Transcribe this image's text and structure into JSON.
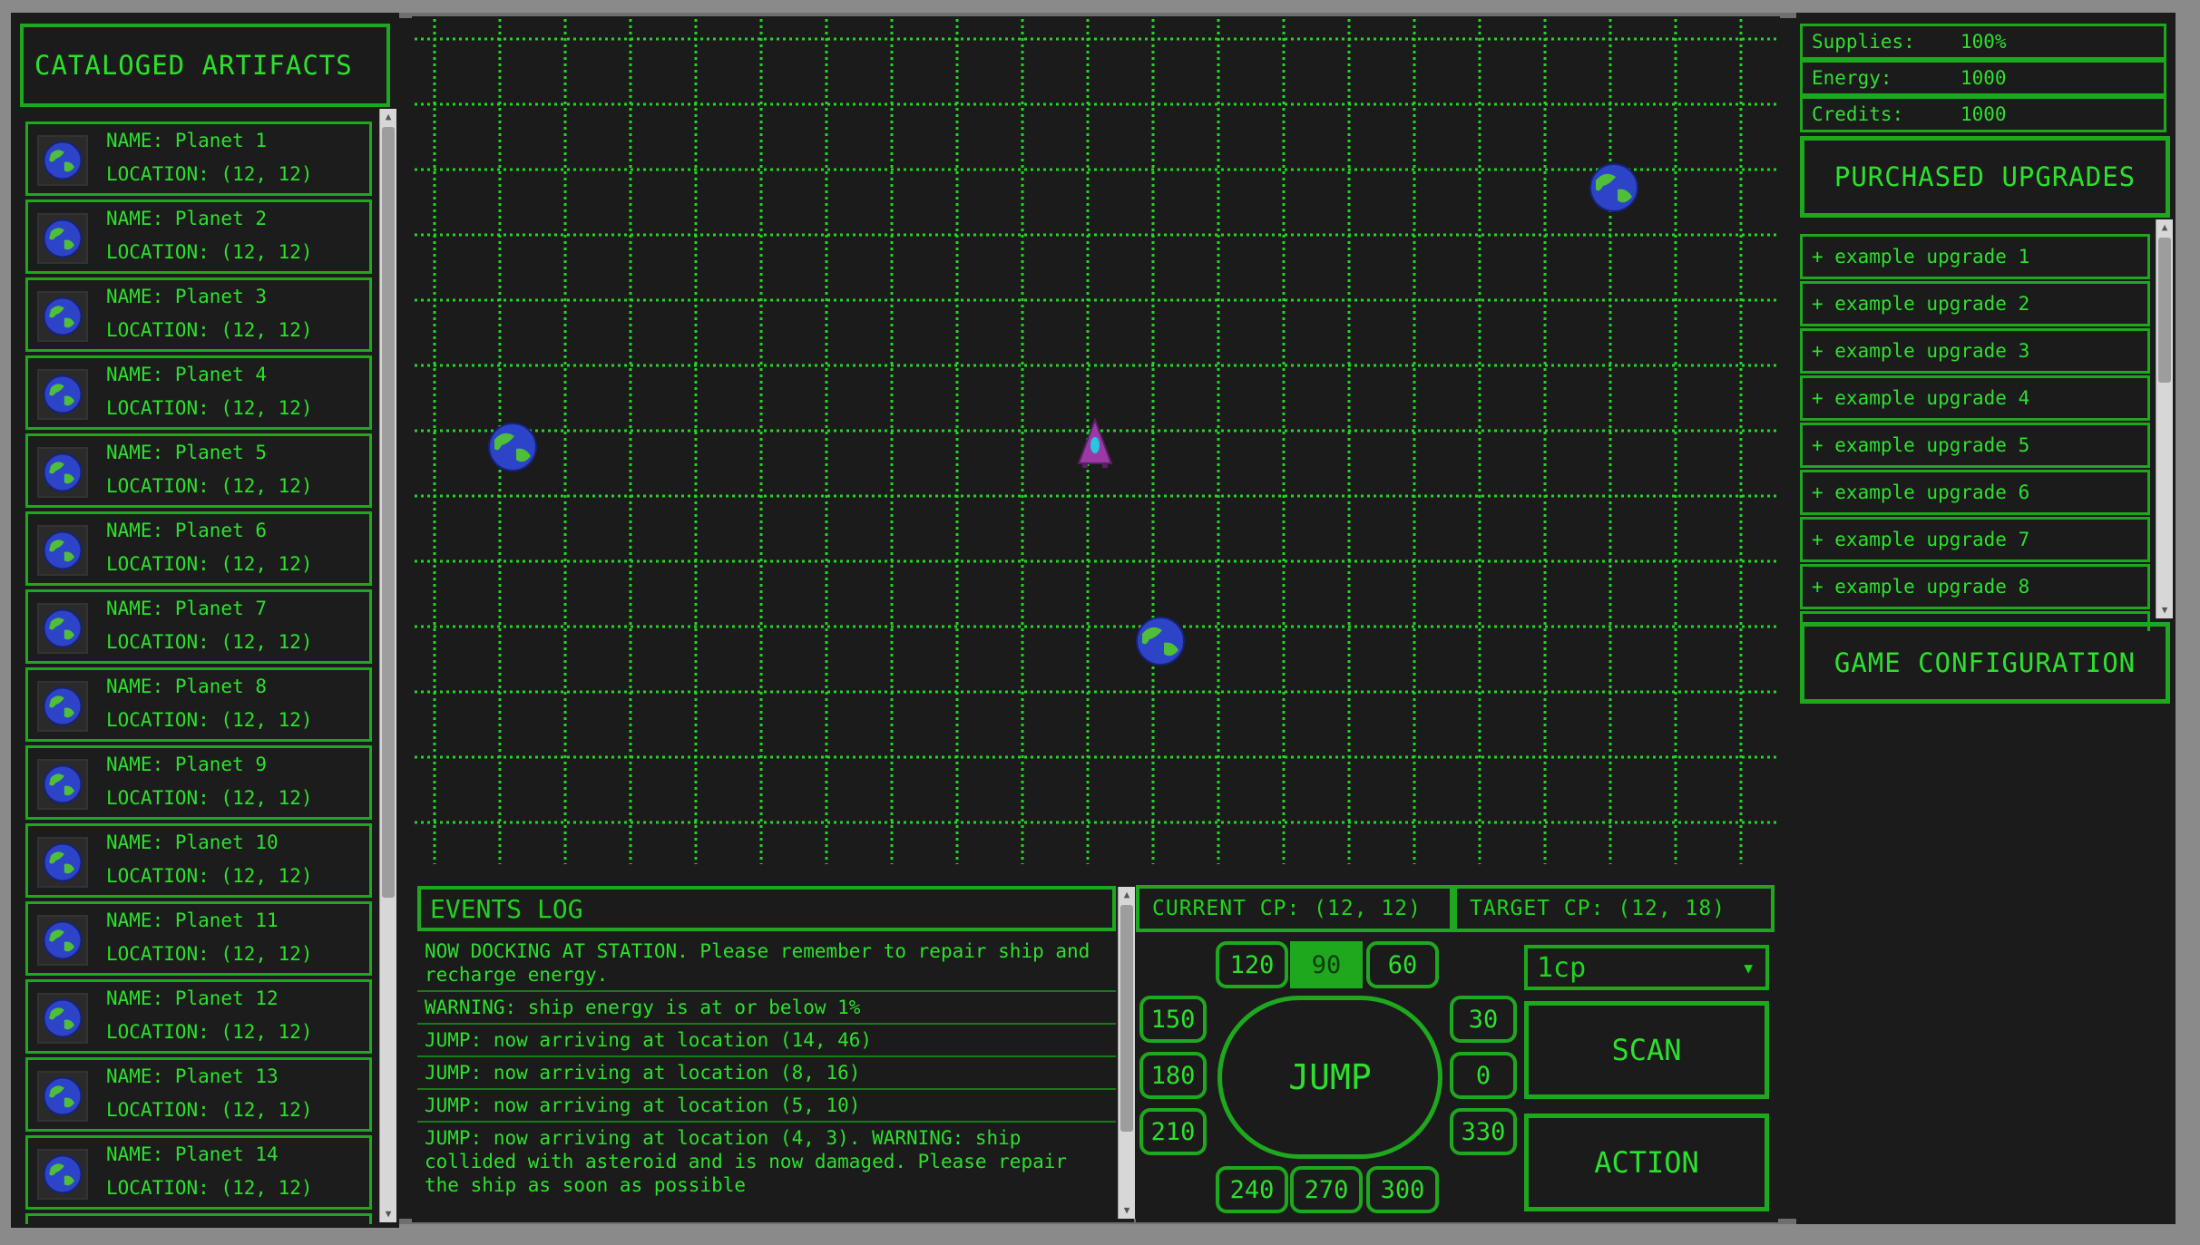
{
  "artifacts": {
    "title": "CATALOGED ARTIFACTS",
    "items": [
      {
        "name": "NAME: Planet 1",
        "location": "LOCATION: (12, 12)"
      },
      {
        "name": "NAME: Planet 2",
        "location": "LOCATION: (12, 12)"
      },
      {
        "name": "NAME: Planet 3",
        "location": "LOCATION: (12, 12)"
      },
      {
        "name": "NAME: Planet 4",
        "location": "LOCATION: (12, 12)"
      },
      {
        "name": "NAME: Planet 5",
        "location": "LOCATION: (12, 12)"
      },
      {
        "name": "NAME: Planet 6",
        "location": "LOCATION: (12, 12)"
      },
      {
        "name": "NAME: Planet 7",
        "location": "LOCATION: (12, 12)"
      },
      {
        "name": "NAME: Planet 8",
        "location": "LOCATION: (12, 12)"
      },
      {
        "name": "NAME: Planet 9",
        "location": "LOCATION: (12, 12)"
      },
      {
        "name": "NAME: Planet 10",
        "location": "LOCATION: (12, 12)"
      },
      {
        "name": "NAME: Planet 11",
        "location": "LOCATION: (12, 12)"
      },
      {
        "name": "NAME: Planet 12",
        "location": "LOCATION: (12, 12)"
      },
      {
        "name": "NAME: Planet 13",
        "location": "LOCATION: (12, 12)"
      },
      {
        "name": "NAME: Planet 14",
        "location": "LOCATION: (12, 12)"
      }
    ],
    "icon": "planet-icon"
  },
  "map": {
    "icons": [
      "planet-icon",
      "ship-icon"
    ]
  },
  "events": {
    "title": "EVENTS LOG",
    "entries": [
      "NOW DOCKING AT STATION. Please remember to repair ship and recharge energy.",
      "WARNING: ship energy is at or below 1%",
      "JUMP: now arriving at location (14, 46)",
      "JUMP: now arriving at location (8, 16)",
      "JUMP: now arriving at location (5, 10)",
      "JUMP: now arriving at location (4, 3). WARNING: ship collided with asteroid and is now damaged. Please repair the ship as soon as possible"
    ]
  },
  "controls": {
    "current_cp": "CURRENT CP: (12, 12)",
    "target_cp": "TARGET CP: (12, 18)",
    "angles": {
      "a120": "120",
      "a90": "90",
      "a60": "60",
      "a150": "150",
      "a30": "30",
      "a180": "180",
      "a0": "0",
      "a210": "210",
      "a330": "330",
      "a240": "240",
      "a270": "270",
      "a300": "300"
    },
    "active_angle": "90",
    "jump_label": "JUMP",
    "distance_value": "1cp",
    "scan_label": "SCAN",
    "action_label": "ACTION"
  },
  "status": {
    "supplies_label": "Supplies:",
    "supplies_value": "100%",
    "energy_label": "Energy:",
    "energy_value": "1000",
    "credits_label": "Credits:",
    "credits_value": "1000"
  },
  "upgrades": {
    "title": "PURCHASED UPGRADES",
    "items": [
      "+ example upgrade 1",
      "+ example upgrade 2",
      "+ example upgrade 3",
      "+ example upgrade 4",
      "+ example upgrade 5",
      "+ example upgrade 6",
      "+ example upgrade 7",
      "+ example upgrade 8"
    ]
  },
  "config": {
    "title": "GAME CONFIGURATION"
  },
  "colors": {
    "accent": "#1ea81e",
    "text": "#2de02d",
    "background": "#1b1b1b",
    "frame": "#8a8a8a"
  }
}
